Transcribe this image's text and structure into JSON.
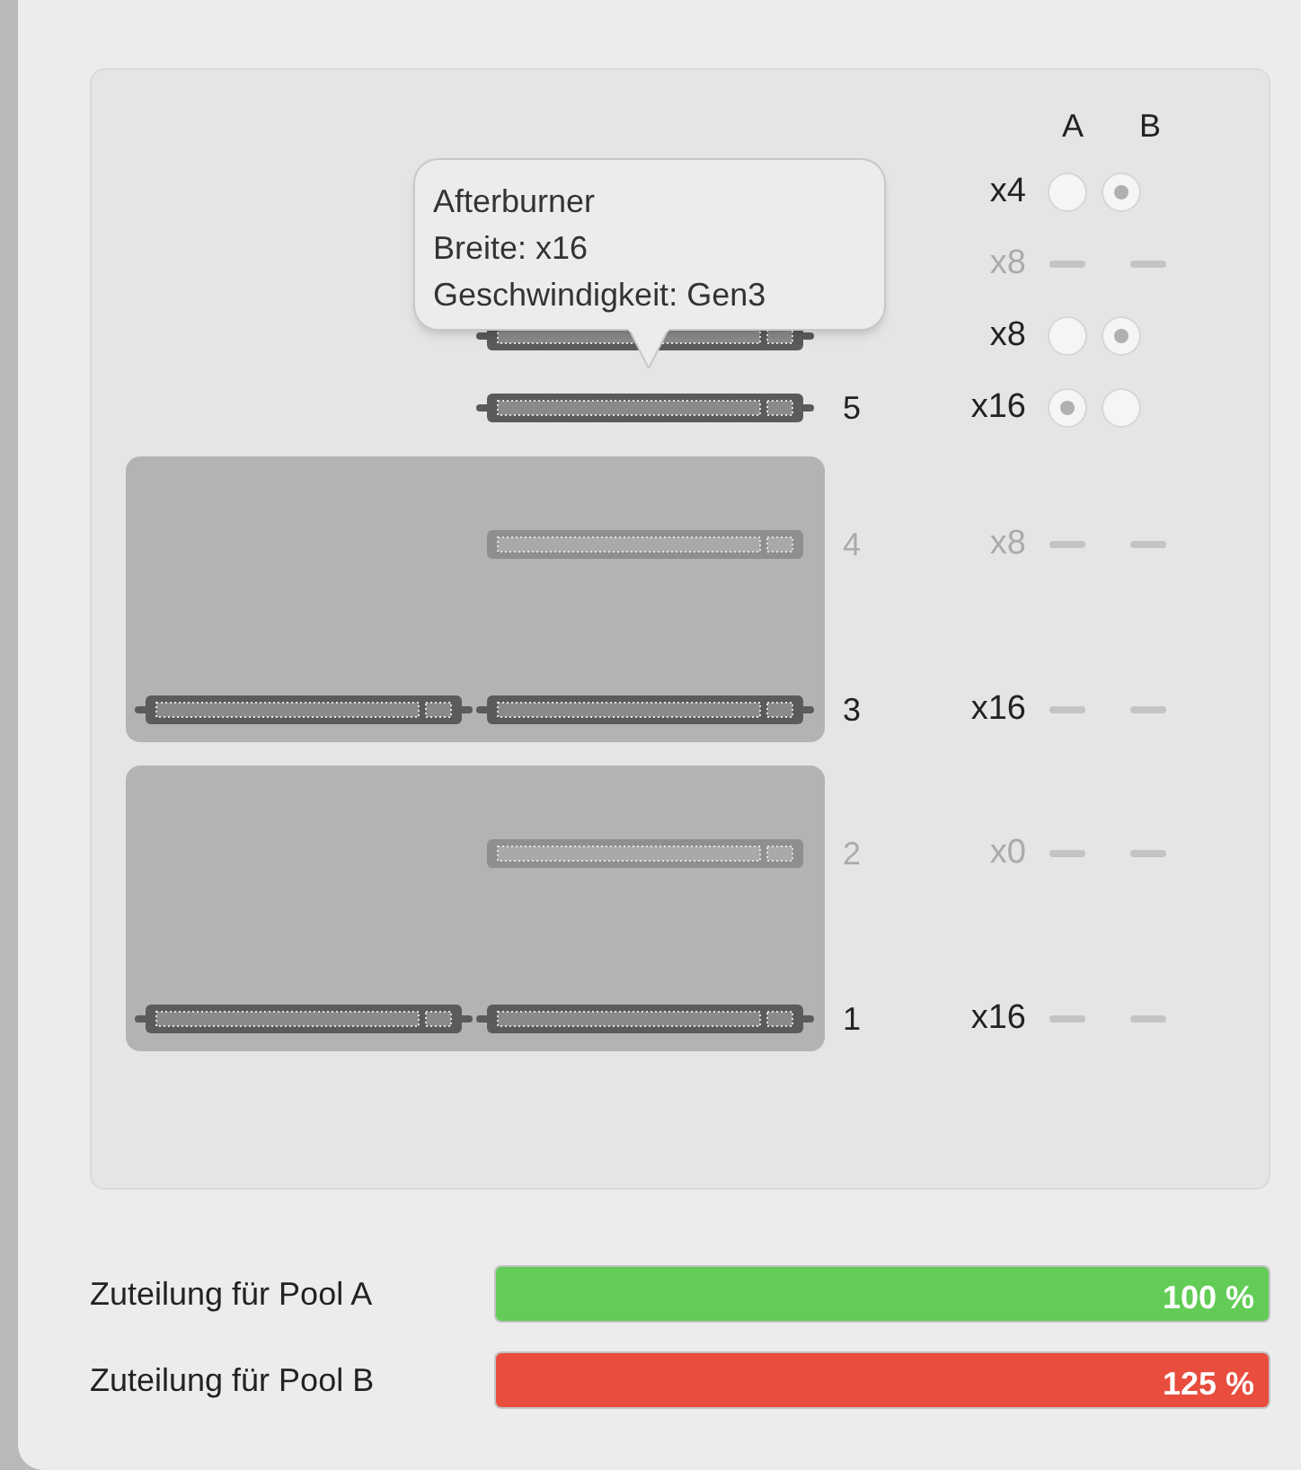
{
  "columns": {
    "a": "A",
    "b": "B"
  },
  "top_slots": [
    {
      "width": "x4",
      "disabled": false,
      "kind": "radio",
      "a_selected": false,
      "b_selected": true,
      "slot": false
    },
    {
      "width": "x8",
      "disabled": true,
      "kind": "dash",
      "slot": false
    },
    {
      "width": "x8",
      "disabled": false,
      "kind": "radio",
      "a_selected": false,
      "b_selected": true,
      "slot": true
    },
    {
      "number": "5",
      "width": "x16",
      "disabled": false,
      "kind": "radio",
      "a_selected": true,
      "b_selected": false,
      "slot": true
    }
  ],
  "groups": [
    {
      "rows": [
        {
          "number": "4",
          "width": "x8",
          "disabled": true,
          "kind": "dash",
          "second_slot": false
        },
        {
          "number": "3",
          "width": "x16",
          "disabled": false,
          "kind": "dash",
          "second_slot": true
        }
      ]
    },
    {
      "rows": [
        {
          "number": "2",
          "width": "x0",
          "disabled": true,
          "kind": "dash",
          "second_slot": false
        },
        {
          "number": "1",
          "width": "x16",
          "disabled": false,
          "kind": "dash",
          "second_slot": true
        }
      ]
    }
  ],
  "tooltip": {
    "lines": [
      "Afterburner",
      "Breite: x16",
      "Geschwindigkeit: Gen3"
    ]
  },
  "pools": [
    {
      "label": "Zuteilung für Pool A",
      "value": "100 %",
      "level": 1,
      "color": "#62cc56"
    },
    {
      "label": "Zuteilung für Pool B",
      "value": "125 %",
      "level": 1,
      "color": "#e84d3d"
    }
  ]
}
